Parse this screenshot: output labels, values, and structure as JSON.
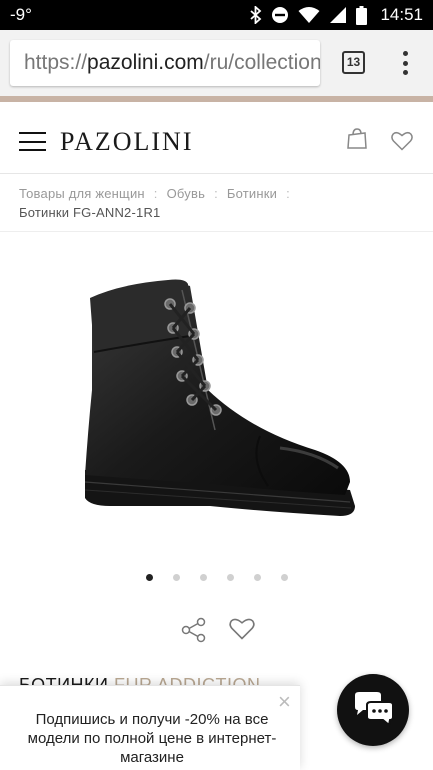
{
  "status_bar": {
    "temperature": "-9°",
    "time": "14:51",
    "icons": [
      "bluetooth-icon",
      "do-not-disturb-icon",
      "wifi-icon",
      "signal-icon",
      "battery-icon"
    ]
  },
  "browser": {
    "url_scheme": "https://",
    "url_host": "pazolini.com",
    "url_path": "/ru/collection",
    "tab_count": "13"
  },
  "header": {
    "logo": "PAZOLINI"
  },
  "breadcrumb": {
    "items": [
      "Товары для женщин",
      "Обувь",
      "Ботинки"
    ],
    "current": "Ботинки FG-ANN2-1R1"
  },
  "gallery": {
    "total": 6,
    "active_index": 0
  },
  "product": {
    "title_main": "БОТИНКИ",
    "title_sub": "FUR ADDICTION"
  },
  "popup": {
    "text": "Подпишись и получи -20% на все модели по полной цене в интернет-магазине",
    "close": "×"
  },
  "colors": {
    "accent_stripe": "#c8b3a5",
    "title_sub": "#b9a893"
  }
}
